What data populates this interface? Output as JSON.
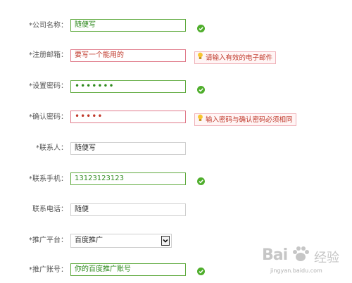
{
  "form": {
    "company": {
      "label": "*公司名称：",
      "value": "随便写"
    },
    "email": {
      "label": "*注册邮箱：",
      "value": "要写一个能用的",
      "tip": "请输入有效的电子邮件"
    },
    "password": {
      "label": "*设置密码：",
      "value": "•••••••"
    },
    "confirm": {
      "label": "*确认密码：",
      "value": "•••••",
      "tip": "输入密码与确认密码必须相同"
    },
    "contact": {
      "label": "*联系人：",
      "value": "随便写"
    },
    "mobile": {
      "label": "*联系手机：",
      "value": "13123123123"
    },
    "phone": {
      "label": "联系电话：",
      "value": "随便"
    },
    "platform": {
      "label": "*推广平台：",
      "selected": "百度推广"
    },
    "account": {
      "label": "*推广账号：",
      "value": "你的百度推广账号"
    }
  },
  "colors": {
    "ok": "#4fae2c",
    "error": "#c0392b",
    "tip_bg": "#fff5f5"
  },
  "icons": {
    "ok": "check-circle-icon",
    "tip": "lightbulb-icon",
    "select": "chevron-down-icon"
  },
  "watermark": {
    "logo": "Bai",
    "logo2": "经验",
    "url": "jingyan.baidu.com"
  }
}
